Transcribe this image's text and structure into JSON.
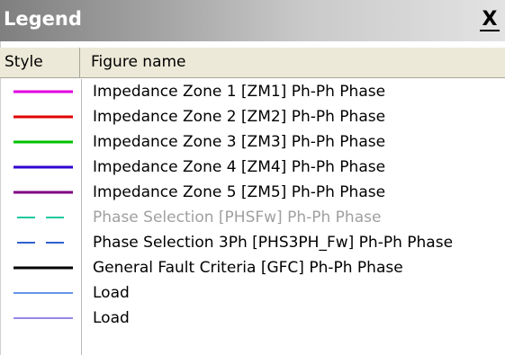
{
  "window": {
    "title": "Legend",
    "close_label": "X"
  },
  "table": {
    "columns": [
      "Style",
      "Figure name"
    ],
    "rows": [
      {
        "name": "Impedance Zone 1 [ZM1] Ph-Ph Phase",
        "color": "#e000e0",
        "line": "solid",
        "enabled": true
      },
      {
        "name": "Impedance Zone 2 [ZM2] Ph-Ph Phase",
        "color": "#e00000",
        "line": "solid",
        "enabled": true
      },
      {
        "name": "Impedance Zone 3 [ZM3] Ph-Ph Phase",
        "color": "#00c000",
        "line": "solid",
        "enabled": true
      },
      {
        "name": "Impedance Zone 4 [ZM4] Ph-Ph Phase",
        "color": "#3000d0",
        "line": "solid",
        "enabled": true
      },
      {
        "name": "Impedance Zone 5 [ZM5] Ph-Ph Phase",
        "color": "#800080",
        "line": "solid",
        "enabled": true
      },
      {
        "name": "Phase Selection [PHSFw] Ph-Ph Phase",
        "color": "#20c8a0",
        "line": "dashed",
        "enabled": false
      },
      {
        "name": "Phase Selection 3Ph [PHS3PH_Fw] Ph-Ph Phase",
        "color": "#3060d0",
        "line": "dashed",
        "enabled": true
      },
      {
        "name": "General Fault Criteria [GFC] Ph-Ph Phase",
        "color": "#000000",
        "line": "solid",
        "enabled": true
      },
      {
        "name": "Load",
        "color": "#3070e0",
        "line": "thin",
        "enabled": true
      },
      {
        "name": "Load",
        "color": "#7060e0",
        "line": "thin",
        "enabled": true
      }
    ]
  }
}
